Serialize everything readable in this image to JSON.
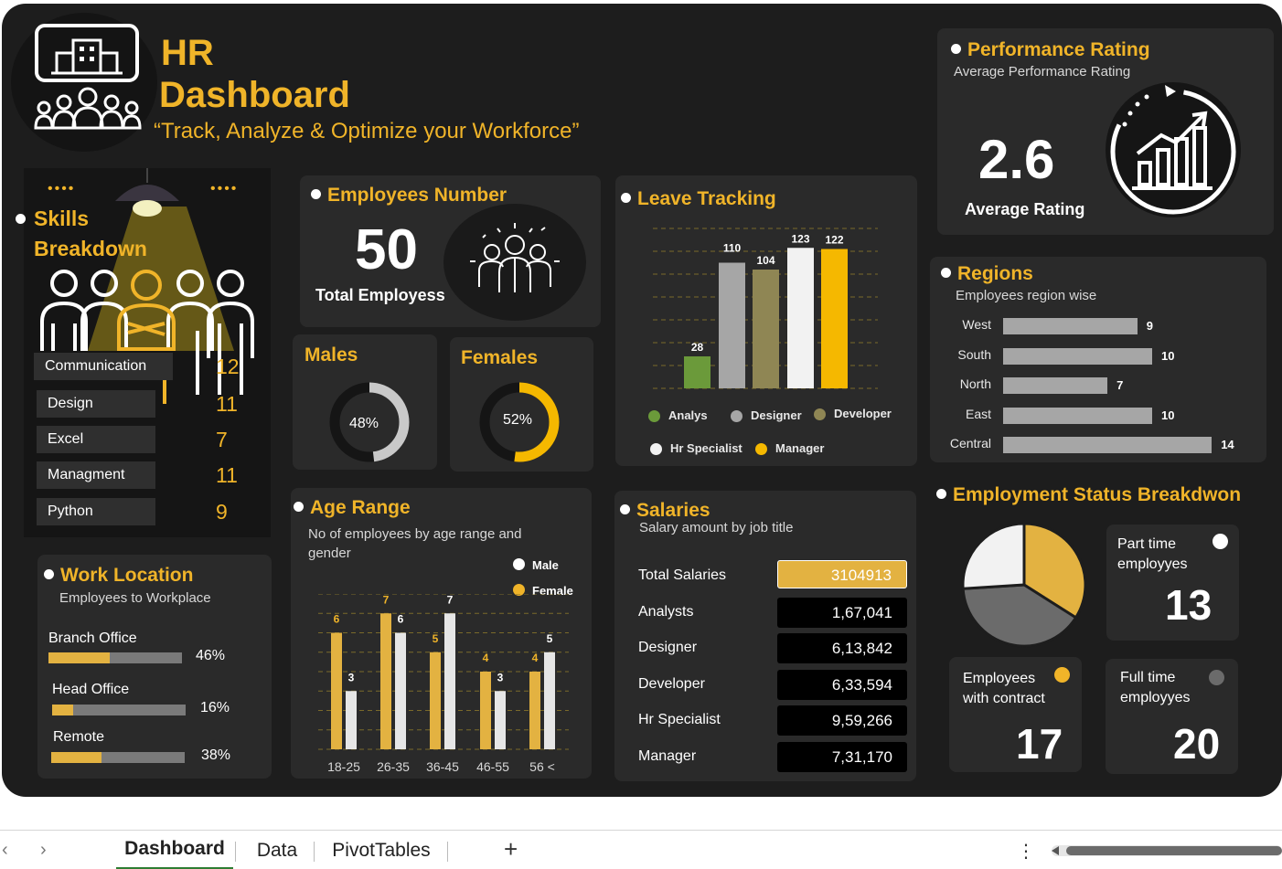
{
  "header": {
    "title_line1": "HR",
    "title_line2": "Dashboard",
    "tagline": "“Track, Analyze & Optimize your Workforce”"
  },
  "colors": {
    "gold": "#f0b429",
    "panel": "#2a2a2a",
    "board": "#1d1d1d",
    "grey": "#a6a6a6",
    "olive": "#8f8654",
    "green": "#6b9a3a"
  },
  "icons": {
    "logo": "building-people-icon",
    "skills": "team-people-icon",
    "employees": "group-people-icon",
    "performance": "growth-chart-icon"
  },
  "skills": {
    "title_line1": "Skills",
    "title_line2": "Breakdown",
    "decor_left": "••••",
    "decor_right": "••••",
    "items": [
      {
        "label": "Communication",
        "value": "12"
      },
      {
        "label": "Design",
        "value": "11"
      },
      {
        "label": "Excel",
        "value": "7"
      },
      {
        "label": "Managment",
        "value": "11"
      },
      {
        "label": "Python",
        "value": "9"
      }
    ]
  },
  "employees": {
    "title": "Employees Number",
    "value": "50",
    "label": "Total Employess"
  },
  "males": {
    "title": "Males",
    "percent_label": "48%",
    "fraction": 0.48
  },
  "females": {
    "title": "Females",
    "percent_label": "52%",
    "fraction": 0.52
  },
  "leave": {
    "title": "Leave Tracking",
    "legend": [
      "Analys",
      "Designer",
      "Developer",
      "Hr Specialist",
      "Manager"
    ]
  },
  "performance": {
    "title": "Performance Rating",
    "subtitle": "Average Performance Rating",
    "value": "2.6",
    "label": "Average Rating"
  },
  "regions": {
    "title": "Regions",
    "subtitle": "Employees region wise"
  },
  "employment": {
    "title": "Employment Status Breakdwon",
    "part_time_label": "Part time employyes",
    "part_time_value": "13",
    "contract_label": "Employees with contract",
    "contract_value": "17",
    "full_time_label": "Full time employyes",
    "full_time_value": "20"
  },
  "work_location": {
    "title": "Work Location",
    "subtitle": "Employees to Workplace",
    "items": [
      {
        "label": "Branch Office",
        "pct": "46%",
        "fraction": 0.46
      },
      {
        "label": "Head Office",
        "pct": "16%",
        "fraction": 0.16
      },
      {
        "label": "Remote",
        "pct": "38%",
        "fraction": 0.38
      }
    ]
  },
  "age": {
    "title": "Age Range",
    "subtitle": "No of employees by age range and gender",
    "legend_male": "Male",
    "legend_female": "Female"
  },
  "salaries": {
    "title": "Salaries",
    "subtitle": "Salary amount by job title",
    "total_label": "Total Salaries",
    "total_value": "3104913",
    "rows": [
      {
        "label": "Analysts",
        "value": "1,67,041"
      },
      {
        "label": "Designer",
        "value": "6,13,842"
      },
      {
        "label": "Developer",
        "value": "6,33,594"
      },
      {
        "label": "Hr Specialist",
        "value": "9,59,266"
      },
      {
        "label": "Manager",
        "value": "7,31,170"
      }
    ]
  },
  "sheet_tabs": [
    {
      "label": "Dashboard",
      "active": true
    },
    {
      "label": "Data",
      "active": false
    },
    {
      "label": "PivotTables",
      "active": false
    }
  ],
  "sheet_add": "+",
  "sheet_more": "⋮",
  "chart_data": [
    {
      "type": "bar",
      "categories": [
        "Analys",
        "Designer",
        "Developer",
        "Hr Specialist",
        "Manager"
      ],
      "values": [
        28,
        110,
        104,
        123,
        122
      ],
      "colors": [
        "#6b9a3a",
        "#a6a6a6",
        "#8f8654",
        "#f2f2f2",
        "#f5b800"
      ],
      "ylim": [
        0,
        140
      ]
    },
    {
      "type": "bar",
      "categories": [
        "West",
        "South",
        "North",
        "East",
        "Central"
      ],
      "values": [
        9,
        10,
        7,
        10,
        14
      ],
      "orientation": "horizontal"
    },
    {
      "type": "bar",
      "categories": [
        "18-25",
        "26-35",
        "36-45",
        "46-55",
        "56 <"
      ],
      "series": [
        {
          "name": "Female",
          "values": [
            6,
            7,
            5,
            4,
            4
          ]
        },
        {
          "name": "Male",
          "values": [
            3,
            6,
            7,
            3,
            5
          ]
        }
      ],
      "ylim": [
        0,
        8
      ]
    },
    {
      "type": "pie",
      "categories": [
        "Employees with contract",
        "Full time employyes",
        "Part time employyes"
      ],
      "values": [
        17,
        20,
        13
      ],
      "colors": [
        "#e3b241",
        "#6b6b6b",
        "#f2f2f2"
      ]
    }
  ]
}
